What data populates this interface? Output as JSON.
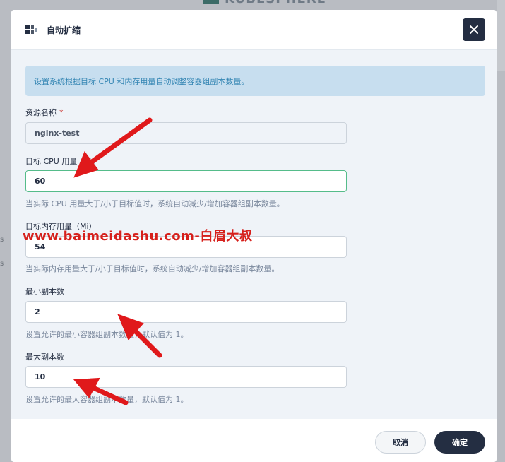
{
  "background": {
    "logo": "KUBESPHERE",
    "side_marks": [
      "s",
      "s"
    ]
  },
  "dialog": {
    "title": "自动扩缩",
    "notice": "设置系统根据目标 CPU 和内存用量自动调整容器组副本数量。",
    "fields": [
      {
        "label": "资源名称",
        "required_mark": "*",
        "value": "nginx-test",
        "hint": ""
      },
      {
        "label": "目标 CPU 用量（%）",
        "value": "60",
        "hint": "当实际 CPU 用量大于/小于目标值时，系统自动减少/增加容器组副本数量。"
      },
      {
        "label": "目标内存用量（Mi）",
        "value": "54",
        "hint": "当实际内存用量大于/小于目标值时，系统自动减少/增加容器组副本数量。"
      },
      {
        "label": "最小副本数",
        "value": "2",
        "hint": "设置允许的最小容器组副本数量，默认值为 1。"
      },
      {
        "label": "最大副本数",
        "value": "10",
        "hint": "设置允许的最大容器组副本数量，默认值为 1。"
      }
    ],
    "buttons": {
      "cancel": "取消",
      "ok": "确定"
    }
  },
  "watermark": "www.baimeidashu.com-白眉大叔",
  "colors": {
    "accent_dark": "#242e42",
    "active_border": "#55bc8a",
    "annotation_red": "#e0191b",
    "notice_bg": "#c7deef"
  },
  "icons": {
    "title_icon": "autoscale-icon",
    "close": "close-icon"
  }
}
